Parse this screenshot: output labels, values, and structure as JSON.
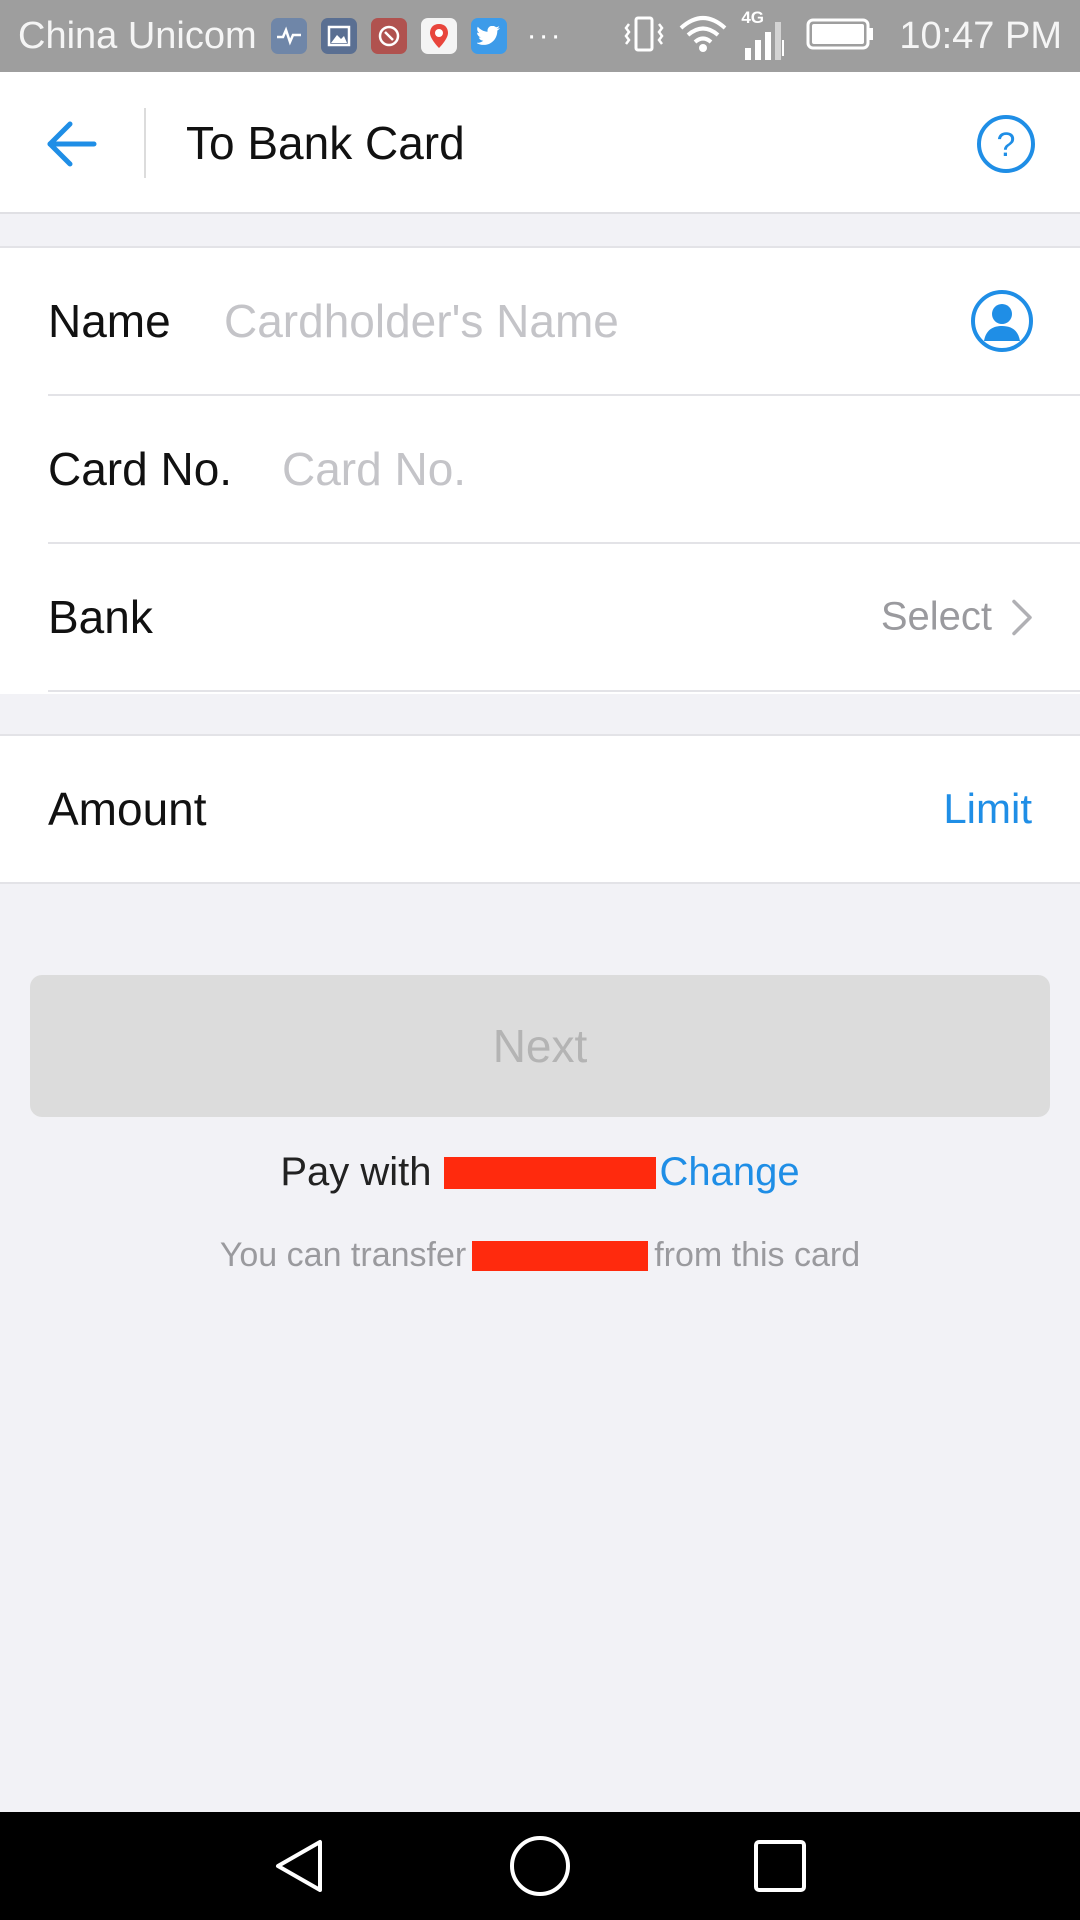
{
  "status_bar": {
    "carrier": "China Unicom",
    "network": "4G",
    "time": "10:47 PM",
    "notification_icons": [
      "health-icon",
      "gallery-icon",
      "app-icon",
      "maps-icon",
      "twitter-icon"
    ],
    "overflow": "···"
  },
  "header": {
    "title": "To Bank Card",
    "back_icon": "arrow-left-icon",
    "help_icon": "question-circle-icon"
  },
  "form": {
    "name_label": "Name",
    "name_placeholder": "Cardholder's Name",
    "card_label": "Card No.",
    "card_placeholder": "Card No.",
    "bank_label": "Bank",
    "bank_value": "Select"
  },
  "amount": {
    "label": "Amount",
    "limit_link": "Limit"
  },
  "actions": {
    "next_label": "Next",
    "pay_with_prefix": "Pay with",
    "change_link": "Change",
    "transfer_prefix": "You can transfer",
    "transfer_suffix": "from this card"
  },
  "colors": {
    "accent": "#1f8ee6",
    "redaction": "#ff2a0d",
    "background": "#f2f2f6"
  }
}
